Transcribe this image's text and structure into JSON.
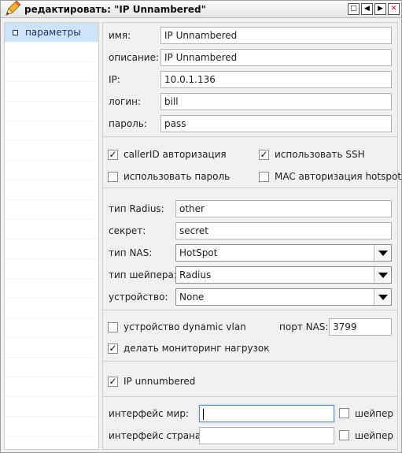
{
  "window": {
    "title": "редактировать: \"IP Unnambered\"",
    "buttons": {
      "maximize": "□",
      "prev": "◀",
      "next": "▶",
      "close": "✕"
    }
  },
  "sidebar": {
    "items": [
      {
        "label": "параметры",
        "selected": true
      }
    ]
  },
  "general": {
    "name_label": "имя:",
    "name_value": "IP Unnambered",
    "desc_label": "описание:",
    "desc_value": "IP Unnambered",
    "ip_label": "IP:",
    "ip_value": "10.0.1.136",
    "login_label": "логин:",
    "login_value": "bill",
    "password_label": "пароль:",
    "password_value": "pass"
  },
  "auth": {
    "callerid_label": "callerID авторизация",
    "callerid_checked": true,
    "ssh_label": "использовать SSH",
    "ssh_checked": true,
    "use_password_label": "использовать пароль",
    "use_password_checked": false,
    "mac_label": "MAC авторизация hotspot",
    "mac_checked": false
  },
  "radius": {
    "type_label": "тип Radius:",
    "type_value": "other",
    "secret_label": "секрет:",
    "secret_value": "secret",
    "nas_label": "тип NAS:",
    "nas_value": "HotSpot",
    "shaper_label": "тип шейпера:",
    "shaper_value": "Radius",
    "device_label": "устройство:",
    "device_value": "None"
  },
  "vlan": {
    "dynamic_label": "устройство dynamic vlan",
    "dynamic_checked": false,
    "port_label": "порт NAS:",
    "port_value": "3799",
    "monitor_label": "делать мониторинг нагрузок",
    "monitor_checked": true
  },
  "unnumbered": {
    "label": "IP unnumbered",
    "checked": true
  },
  "interfaces": {
    "world_label": "интерфейс мир:",
    "world_value": "",
    "world_shaper_label": "шейпер",
    "world_shaper_checked": false,
    "country_label": "интерфейс страна:",
    "country_value": "",
    "country_shaper_label": "шейпер",
    "country_shaper_checked": false
  }
}
